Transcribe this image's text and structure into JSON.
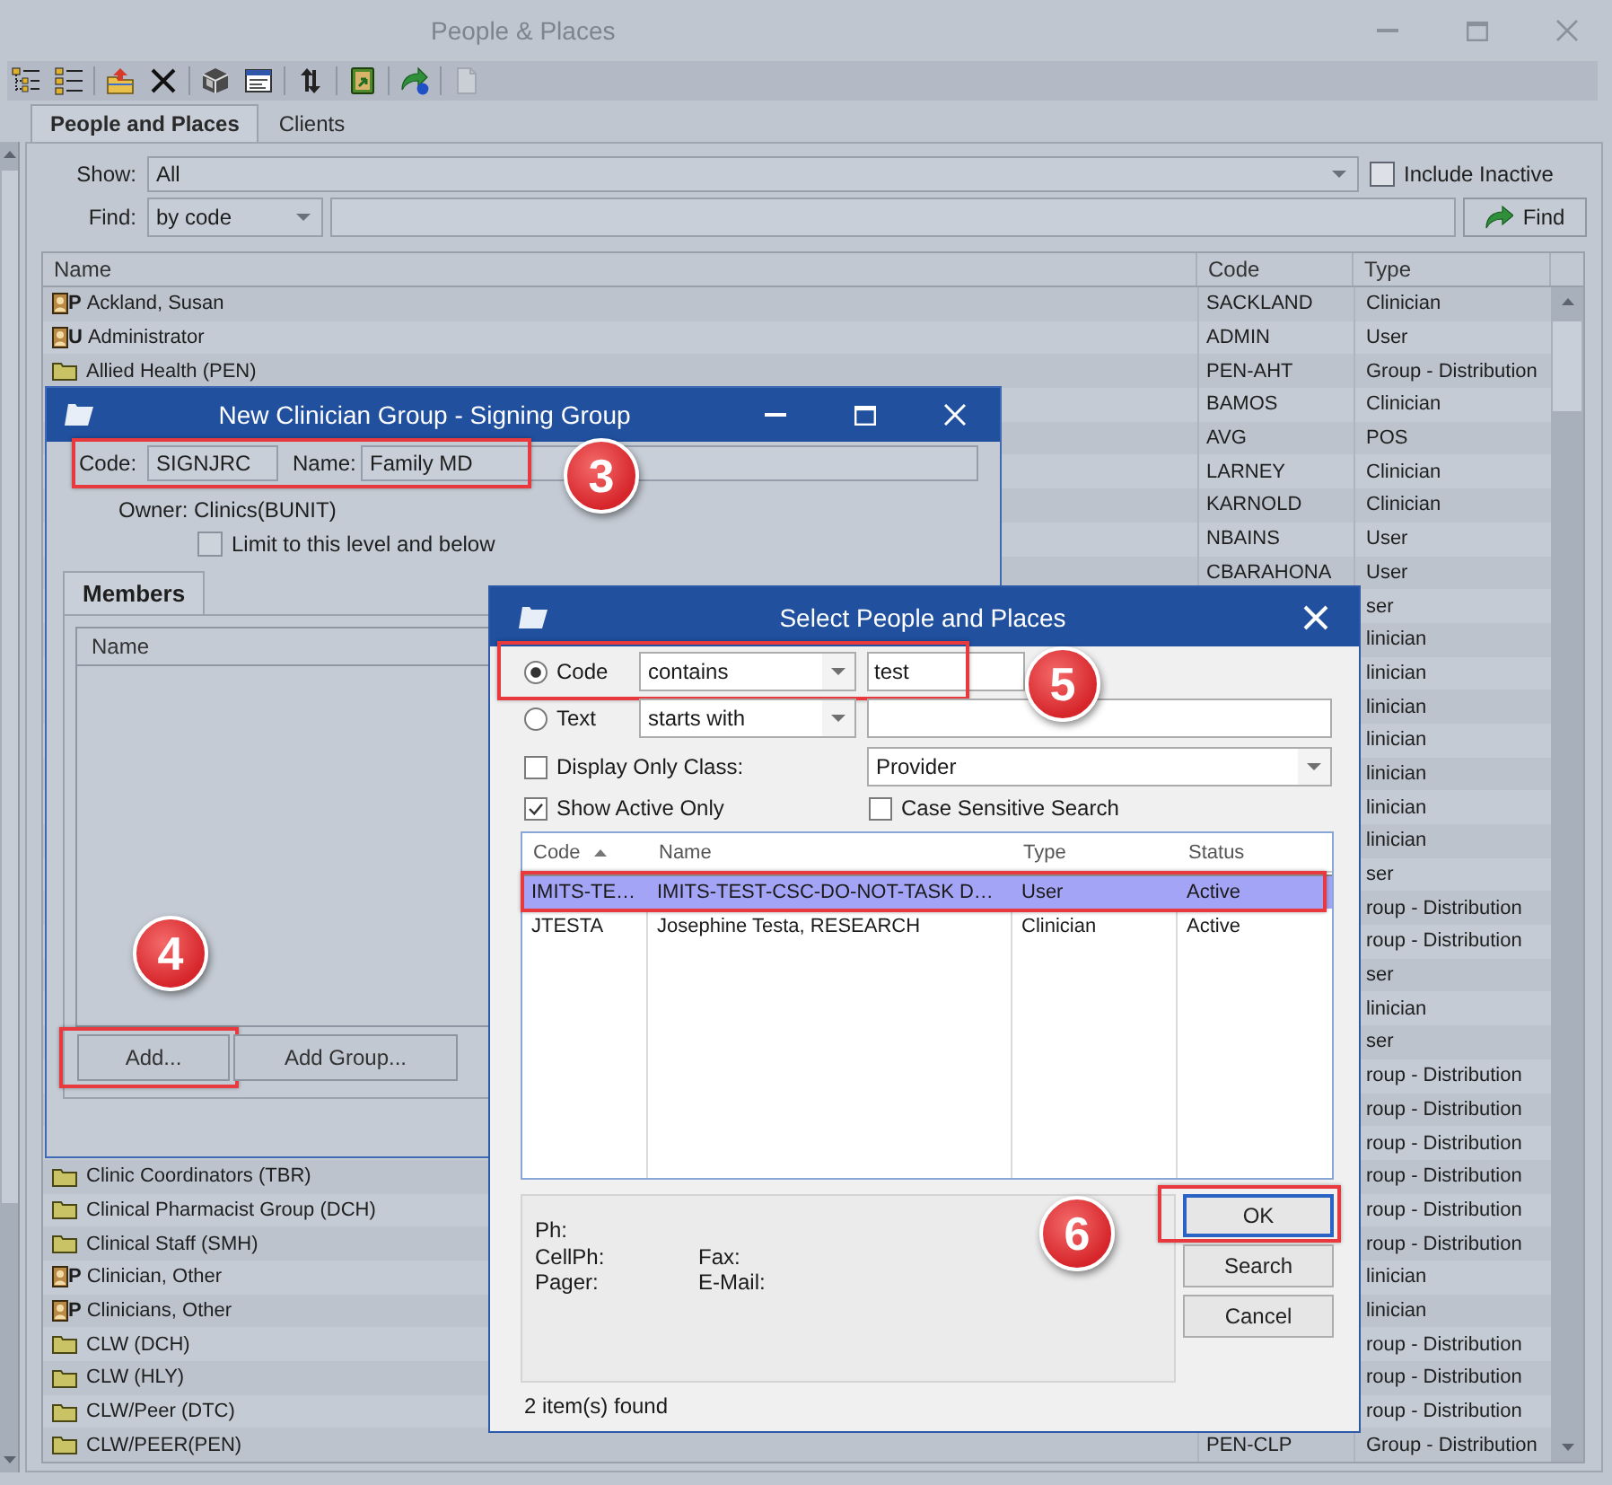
{
  "window": {
    "title": "People & Places"
  },
  "toolbar": [
    {
      "kind": "tree",
      "disabled": false
    },
    {
      "kind": "list",
      "disabled": false
    },
    {
      "kind": "folder-up",
      "disabled": false
    },
    {
      "kind": "delete",
      "disabled": false
    },
    {
      "kind": "box",
      "disabled": false
    },
    {
      "kind": "form",
      "disabled": false
    },
    {
      "kind": "swap",
      "disabled": false
    },
    {
      "kind": "book",
      "disabled": false
    },
    {
      "kind": "forward",
      "disabled": false
    },
    {
      "kind": "document",
      "disabled": true
    }
  ],
  "tabs": [
    {
      "label": "People and Places",
      "selected": true
    },
    {
      "label": "Clients",
      "selected": false
    }
  ],
  "filter": {
    "show_label": "Show:",
    "show_value": "All",
    "include_inactive": {
      "label": "Include Inactive",
      "checked": false
    },
    "find_label": "Find:",
    "find_mode": "by code",
    "find_button": "Find"
  },
  "grid": {
    "columns": [
      "Name",
      "Code",
      "Type"
    ],
    "rows": [
      {
        "kind": "person",
        "tag": "P",
        "name": "Ackland, Susan",
        "code": "SACKLAND",
        "type": "Clinician"
      },
      {
        "kind": "person",
        "tag": "U",
        "name": "Administrator",
        "code": "ADMIN",
        "type": "User"
      },
      {
        "kind": "folder",
        "name": "Allied Health (PEN)",
        "code": "PEN-AHT",
        "type": "Group - Distribution"
      },
      {
        "code": "BAMOS",
        "type": "Clinician"
      },
      {
        "code": "AVG",
        "type": "POS"
      },
      {
        "code": "LARNEY",
        "type": "Clinician"
      },
      {
        "code": "KARNOLD",
        "type": "Clinician"
      },
      {
        "code": "NBAINS",
        "type": "User"
      },
      {
        "code": "CBARAHONA",
        "type": "User"
      },
      {
        "type": "ser"
      },
      {
        "type": "linician"
      },
      {
        "type": "linician"
      },
      {
        "type": "linician"
      },
      {
        "type": "linician"
      },
      {
        "type": "linician"
      },
      {
        "type": "linician"
      },
      {
        "type": "linician"
      },
      {
        "type": "ser"
      },
      {
        "type": "roup - Distribution"
      },
      {
        "type": "roup - Distribution"
      },
      {
        "type": "ser"
      },
      {
        "type": "linician"
      },
      {
        "type": "ser"
      },
      {
        "type": "roup - Distribution"
      },
      {
        "type": "roup - Distribution"
      },
      {
        "type": "roup - Distribution"
      },
      {
        "kind": "folder",
        "name": "Clinic Coordinators (TBR)",
        "type": "roup - Distribution"
      },
      {
        "kind": "folder",
        "name": "Clinical Pharmacist Group (DCH)",
        "type": "roup - Distribution"
      },
      {
        "kind": "folder",
        "name": "Clinical Staff (SMH)",
        "type": "roup - Distribution"
      },
      {
        "kind": "person",
        "tag": "P",
        "name": "Clinician, Other",
        "type": "linician"
      },
      {
        "kind": "person",
        "tag": "P",
        "name": "Clinicians, Other",
        "type": "linician"
      },
      {
        "kind": "folder",
        "name": "CLW (DCH)",
        "type": "roup - Distribution"
      },
      {
        "kind": "folder",
        "name": "CLW (HLY)",
        "type": "roup - Distribution"
      },
      {
        "kind": "folder",
        "name": "CLW/Peer (DTC)",
        "type": "roup - Distribution"
      },
      {
        "kind": "folder",
        "name": "CLW/PEER(PEN)",
        "code": "PEN-CLP",
        "type": "Group - Distribution"
      }
    ]
  },
  "group_dialog": {
    "title": "New Clinician Group - Signing Group",
    "ident": {
      "code_label": "Code:",
      "code": "SIGNJRC",
      "name_label": "Name:",
      "name": "Family MD",
      "highlighted": true,
      "callout": "3"
    },
    "owner": "Owner: Clinics(BUNIT)",
    "limit": {
      "label": "Limit to this level and below",
      "checked": false
    },
    "tabs": [
      {
        "label": "Members",
        "selected": true
      }
    ],
    "members": {
      "columns": [
        "Name"
      ]
    },
    "buttons": [
      {
        "label": "Add...",
        "highlighted": true,
        "callout": "4"
      },
      {
        "label": "Add Group...",
        "highlighted": false
      }
    ]
  },
  "select_dialog": {
    "title": "Select People and Places",
    "modes": [
      {
        "label": "Code",
        "selected": true,
        "operator": "contains",
        "value": "test",
        "highlighted": true,
        "callout": "5"
      },
      {
        "label": "Text",
        "selected": false,
        "operator": "starts with",
        "highlighted": false
      }
    ],
    "class_filter": {
      "label": "Display Only Class:",
      "checked": false,
      "value": "Provider"
    },
    "options": [
      {
        "label": "Show Active Only",
        "checked": true
      },
      {
        "label": "Case Sensitive Search",
        "checked": false
      }
    ],
    "results": {
      "columns": [
        {
          "label": "Code",
          "sorted": true
        },
        {
          "label": "Name",
          "sorted": false
        },
        {
          "label": "Type",
          "sorted": false
        },
        {
          "label": "Status",
          "sorted": false
        }
      ],
      "rows": [
        {
          "code": "IMITS-TE…",
          "name": "IMITS-TEST-CSC-DO-NOT-TASK D…",
          "type": "User",
          "status": "Active",
          "selected": true,
          "highlighted": true
        },
        {
          "code": "JTESTA",
          "name": "Josephine Testa, RESEARCH",
          "type": "Clinician",
          "status": "Active",
          "selected": false,
          "highlighted": false
        }
      ]
    },
    "details": {
      "left": [
        "Ph:",
        "CellPh:",
        "Pager:"
      ],
      "right": [
        "Fax:",
        "E-Mail:"
      ]
    },
    "buttons": [
      {
        "label": "OK",
        "default": true,
        "highlighted": true,
        "callout": "6"
      },
      {
        "label": "Search",
        "default": false,
        "highlighted": false
      },
      {
        "label": "Cancel",
        "default": false,
        "highlighted": false
      }
    ],
    "status": "2 item(s) found"
  }
}
